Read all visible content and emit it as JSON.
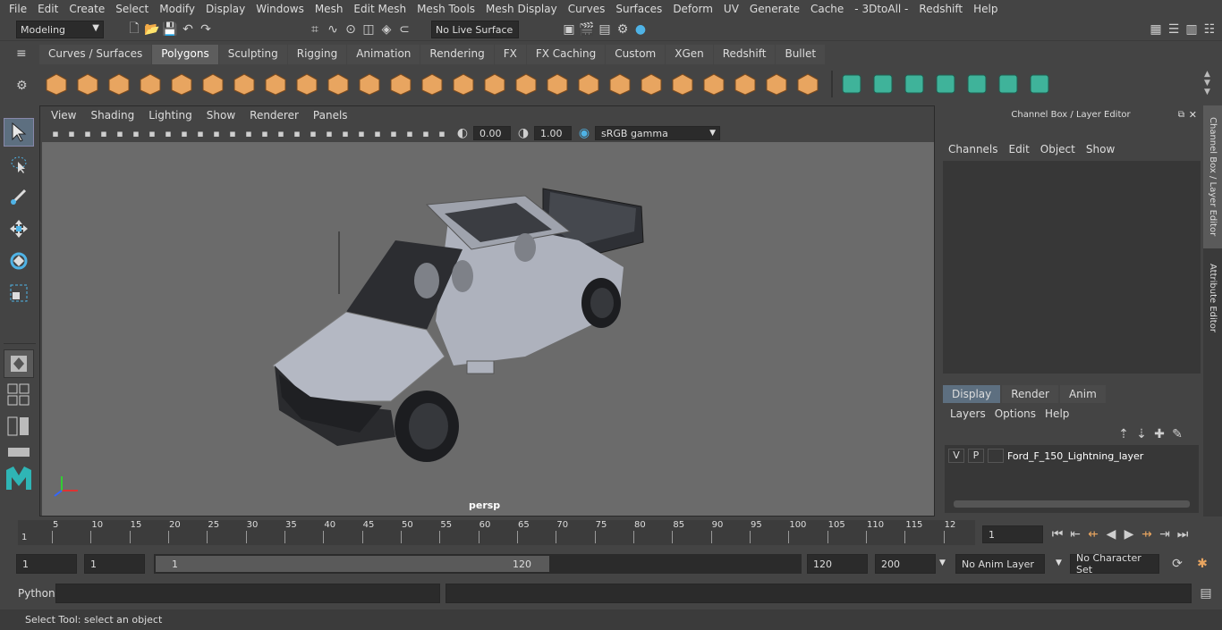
{
  "menubar": [
    "File",
    "Edit",
    "Create",
    "Select",
    "Modify",
    "Display",
    "Windows",
    "Mesh",
    "Edit Mesh",
    "Mesh Tools",
    "Mesh Display",
    "Curves",
    "Surfaces",
    "Deform",
    "UV",
    "Generate",
    "Cache",
    "- 3DtoAll -",
    "Redshift",
    "Help"
  ],
  "status": {
    "mode": "Modeling",
    "live_surface": "No Live Surface"
  },
  "shelf_tabs": [
    "Curves / Surfaces",
    "Polygons",
    "Sculpting",
    "Rigging",
    "Animation",
    "Rendering",
    "FX",
    "FX Caching",
    "Custom",
    "XGen",
    "Redshift",
    "Bullet"
  ],
  "viewport": {
    "menus": [
      "View",
      "Shading",
      "Lighting",
      "Show",
      "Renderer",
      "Panels"
    ],
    "exposure": "0.00",
    "gamma": "1.00",
    "colorspace": "sRGB gamma",
    "camera": "persp"
  },
  "channelbox": {
    "title": "Channel Box / Layer Editor",
    "menus": [
      "Channels",
      "Edit",
      "Object",
      "Show"
    ]
  },
  "layers": {
    "tabs": [
      "Display",
      "Render",
      "Anim"
    ],
    "menus": [
      "Layers",
      "Options",
      "Help"
    ],
    "rows": [
      {
        "v": "V",
        "p": "P",
        "name": "Ford_F_150_Lightning_layer"
      }
    ]
  },
  "sidetabs": {
    "channel": "Channel Box / Layer Editor",
    "attr": "Attribute Editor"
  },
  "timeline": {
    "ticks": [
      "5",
      "10",
      "15",
      "20",
      "25",
      "30",
      "35",
      "40",
      "45",
      "50",
      "55",
      "60",
      "65",
      "70",
      "75",
      "80",
      "85",
      "90",
      "95",
      "100",
      "105",
      "110",
      "115",
      "12"
    ],
    "start_label": "1",
    "current": "1"
  },
  "range": {
    "start": "1",
    "playstart": "1",
    "slider_start": "1",
    "slider_end": "120",
    "end": "120",
    "anim_end": "200",
    "anim_layer": "No Anim Layer",
    "char_set": "No Character Set"
  },
  "cmd": {
    "label": "Python"
  },
  "help": "Select Tool: select an object",
  "colors": {
    "shelf_orange": "#e8a560",
    "shelf_teal": "#3fb39a",
    "viewport_bg": "#6b6b6b"
  }
}
